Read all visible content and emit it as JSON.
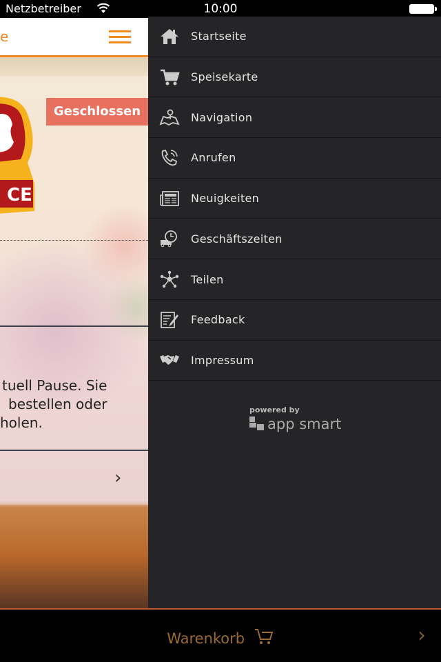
{
  "status_bar": {
    "carrier": "Netzbetreiber",
    "time": "10:00",
    "wifi_icon": "wifi-icon",
    "battery_icon": "battery-icon"
  },
  "header": {
    "title": "e",
    "accent": "#f08a24"
  },
  "main": {
    "logo_text": "CE",
    "status_badge": "Geschlossen",
    "message_lines": [
      "tuell Pause. Sie",
      "bestellen oder",
      "holen."
    ]
  },
  "menu": {
    "items": [
      {
        "label": "Startseite",
        "icon": "home-icon"
      },
      {
        "label": "Speisekarte",
        "icon": "cart-icon"
      },
      {
        "label": "Navigation",
        "icon": "map-icon"
      },
      {
        "label": "Anrufen",
        "icon": "phone-icon"
      },
      {
        "label": "Neuigkeiten",
        "icon": "newspaper-icon"
      },
      {
        "label": "Geschäftszeiten",
        "icon": "clock-truck-icon"
      },
      {
        "label": "Teilen",
        "icon": "share-icon"
      },
      {
        "label": "Feedback",
        "icon": "feedback-icon"
      },
      {
        "label": "Impressum",
        "icon": "handshake-icon"
      }
    ],
    "powered_by": "powered by",
    "brand": "app smart"
  },
  "bottom_bar": {
    "cart_label": "Warenkorb"
  }
}
